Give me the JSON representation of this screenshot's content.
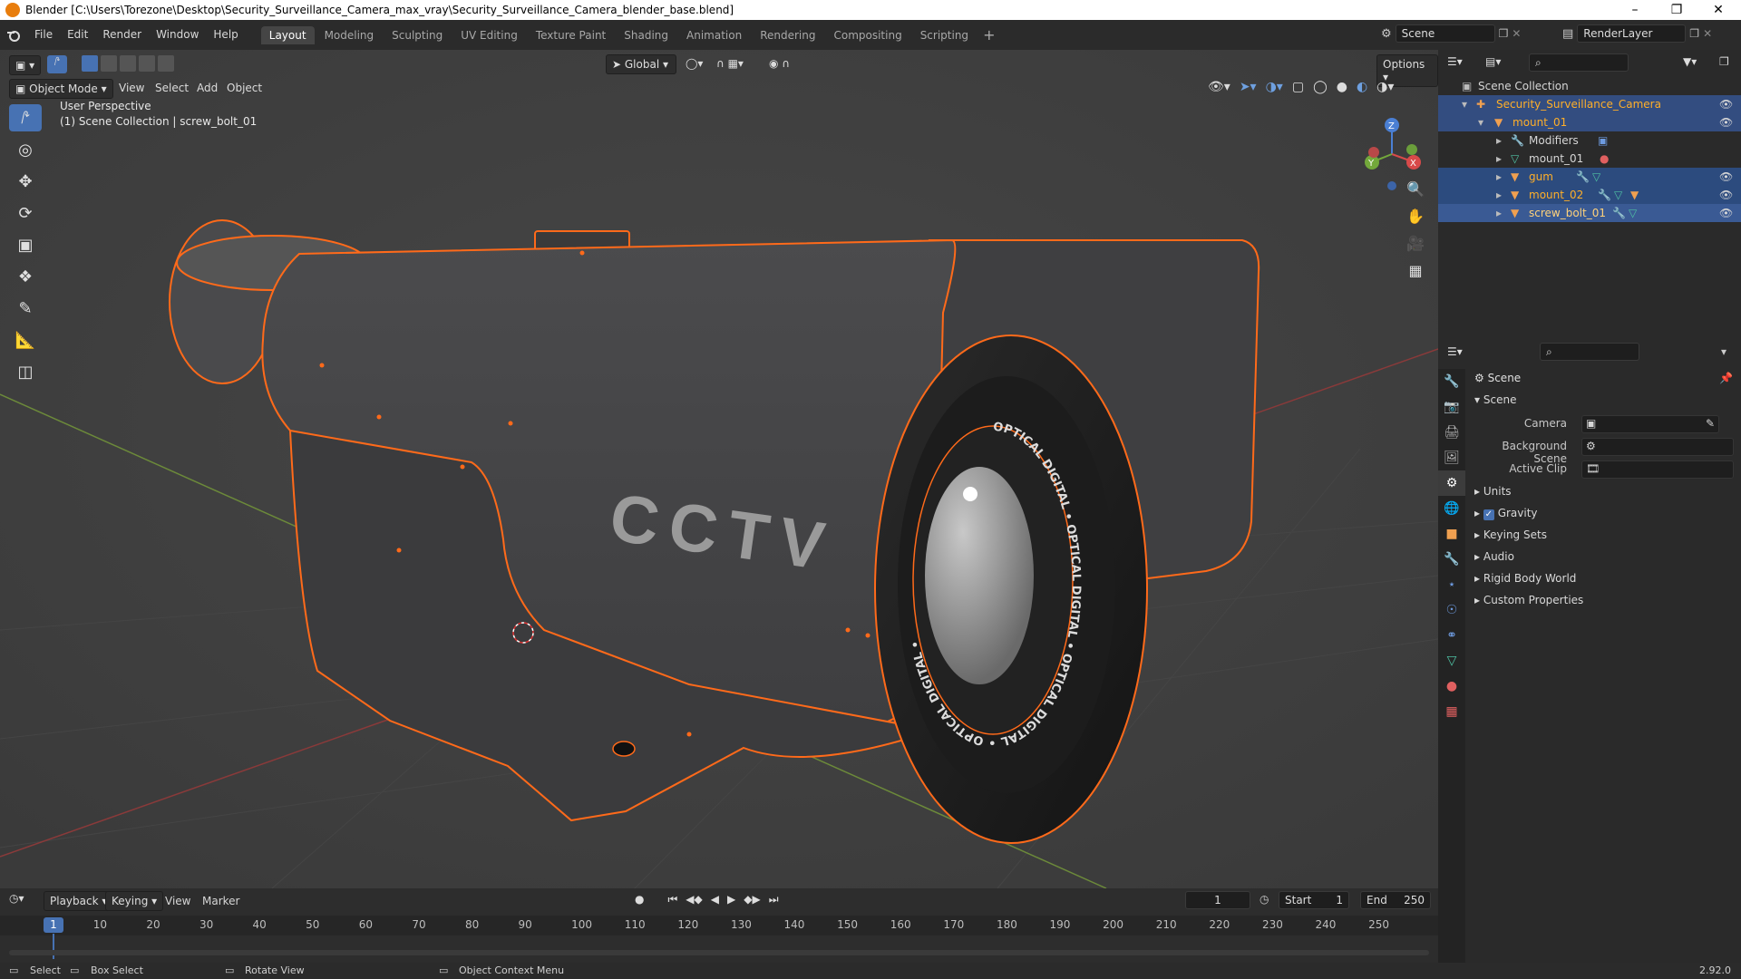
{
  "titlebar": {
    "title": "Blender [C:\\Users\\Torezone\\Desktop\\Security_Surveillance_Camera_max_vray\\Security_Surveillance_Camera_blender_base.blend]",
    "minimize": "–",
    "restore": "❐",
    "close": "✕"
  },
  "menus": [
    "File",
    "Edit",
    "Render",
    "Window",
    "Help"
  ],
  "workspaces": [
    "Layout",
    "Modeling",
    "Sculpting",
    "UV Editing",
    "Texture Paint",
    "Shading",
    "Animation",
    "Rendering",
    "Compositing",
    "Scripting"
  ],
  "active_workspace": "Layout",
  "scene_name": "Scene",
  "render_layer": "RenderLayer",
  "viewport": {
    "mode": "Object Mode",
    "menus": [
      "View",
      "Select",
      "Add",
      "Object"
    ],
    "transform_orientation": "Global",
    "options": "Options",
    "perspective": "User Perspective",
    "collection_info": "(1) Scene Collection | screw_bolt_01",
    "model_label": "CCTV",
    "lens_text": "OPTICAL DIGITAL • OPTICAL DIGITAL • OPTICAL DIGITAL • OPTICAL DIGITAL •",
    "gizmo": {
      "z": "Z",
      "y": "Y",
      "x": "X"
    }
  },
  "timeline": {
    "menus": [
      "Playback",
      "Keying",
      "View",
      "Marker"
    ],
    "current_frame": "1",
    "start_label": "Start",
    "start": "1",
    "end_label": "End",
    "end": "250",
    "ticks": [
      "1",
      "10",
      "20",
      "30",
      "40",
      "50",
      "60",
      "70",
      "80",
      "90",
      "100",
      "110",
      "120",
      "130",
      "140",
      "150",
      "160",
      "170",
      "180",
      "190",
      "200",
      "210",
      "220",
      "230",
      "240",
      "250"
    ]
  },
  "status": {
    "select": "Select",
    "box_select": "Box Select",
    "rotate_view": "Rotate View",
    "context_menu": "Object Context Menu",
    "version": "2.92.0"
  },
  "outliner": {
    "root": "Scene Collection",
    "items": [
      {
        "label": "Security_Surveillance_Camera",
        "type": "empty"
      },
      {
        "label": "mount_01",
        "type": "mesh"
      },
      {
        "label": "Modifiers",
        "type": "modifiers"
      },
      {
        "label": "mount_01",
        "type": "meshdata"
      },
      {
        "label": "gum",
        "type": "mesh"
      },
      {
        "label": "mount_02",
        "type": "mesh"
      },
      {
        "label": "screw_bolt_01",
        "type": "mesh"
      }
    ]
  },
  "properties": {
    "header": "Scene",
    "panel": "Scene",
    "fields": [
      {
        "label": "Camera",
        "value": ""
      },
      {
        "label": "Background Scene",
        "value": ""
      },
      {
        "label": "Active Clip",
        "value": ""
      }
    ],
    "sections": [
      "Units",
      "Gravity",
      "Keying Sets",
      "Audio",
      "Rigid Body World",
      "Custom Properties"
    ]
  },
  "colors": {
    "selection_outline": "#ff6a1a",
    "active_blue": "#4772b3",
    "outliner_selected": "#334d80",
    "active_object_text": "#ffaf29"
  }
}
